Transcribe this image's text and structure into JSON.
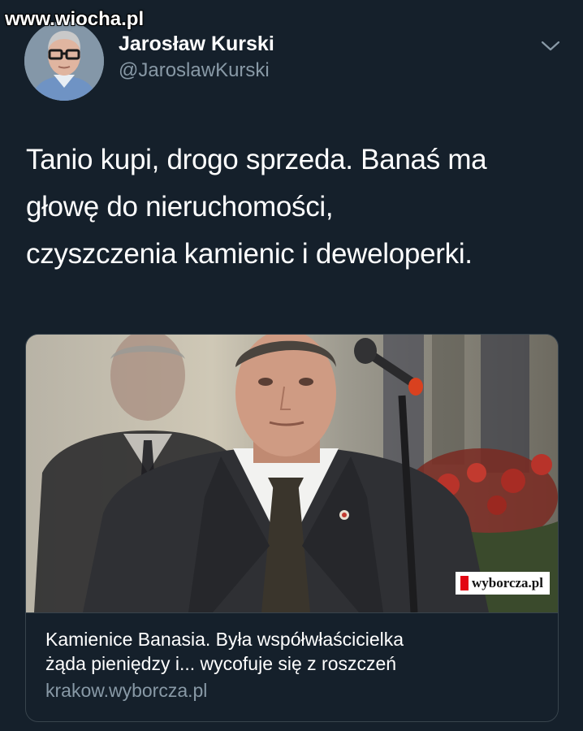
{
  "watermark": "www.wiocha.pl",
  "author": {
    "name": "Jarosław Kurski",
    "handle": "@JaroslawKurski"
  },
  "menu_icon": "chevron-down-icon",
  "tweet": {
    "line1": "Tanio kupi, drogo sprzeda. Banaś ma",
    "line2": "głowę do nieruchomości,",
    "line3": "czyszczenia kamienic i deweloperki."
  },
  "card": {
    "brand": "wyborcza.pl",
    "title_line1": "Kamienice Banasia. Była współwłaścicielka",
    "title_line2": "żąda pieniędzy i... wycofuje się z roszczeń",
    "domain": "krakow.wyborcza.pl"
  },
  "colors": {
    "background": "#15202b",
    "secondary_text": "#8899a6",
    "border": "#38444d",
    "brand_red": "#e30613"
  }
}
